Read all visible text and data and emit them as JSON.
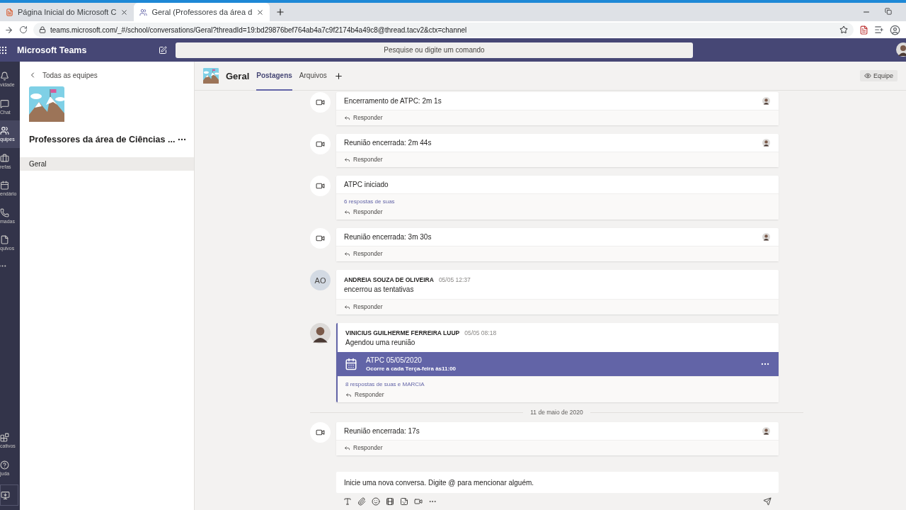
{
  "browser": {
    "tabs": [
      {
        "title": "Página Inicial do Microsoft C",
        "selected": false
      },
      {
        "title": "Geral (Professores da área d",
        "selected": true
      }
    ],
    "url": "teams.microsoft.com/_#/school/conversations/Geral?threadId=19:bd29876bef764ab4a7c9f2174b4a49c8@thread.tacv2&ctx=channel"
  },
  "app": {
    "title": "Microsoft Teams",
    "search": {
      "placeholder": "Pesquise ou digite um comando"
    }
  },
  "rail": {
    "items": [
      {
        "kind": "activity",
        "label": "vidade",
        "selected": false
      },
      {
        "kind": "chat",
        "label": "Chat",
        "selected": false
      },
      {
        "kind": "teams",
        "label": "quipes",
        "selected": true
      },
      {
        "kind": "assignments",
        "label": "refas",
        "selected": false
      },
      {
        "kind": "calendar",
        "label": "endário",
        "selected": false
      },
      {
        "kind": "calls",
        "label": "madas",
        "selected": false
      },
      {
        "kind": "files",
        "label": "quivos",
        "selected": false
      }
    ],
    "bottom": [
      {
        "kind": "apps",
        "label": "cativos"
      },
      {
        "kind": "help",
        "label": "juda"
      }
    ]
  },
  "team_panel": {
    "back": "Todas as equipes",
    "team_name": "Professores da área de Ciências ...",
    "channels": [
      {
        "name": "Geral",
        "selected": true
      }
    ]
  },
  "channel": {
    "name": "Geral",
    "tabs": [
      {
        "label": "Postagens",
        "selected": true
      },
      {
        "label": "Arquivos",
        "selected": false
      }
    ],
    "team_button": "Equipe"
  },
  "messages": [
    {
      "kind": "event",
      "title": "Encerramento de ATPC: 2m 1s",
      "participant": true,
      "reply": "Responder"
    },
    {
      "kind": "event",
      "title": "Reunião encerrada: 2m 44s",
      "participant": true,
      "reply": "Responder"
    },
    {
      "kind": "event",
      "title": "ATPC iniciado",
      "participant": false,
      "replies": "6 respostas de suas",
      "reply": "Responder"
    },
    {
      "kind": "event",
      "title": "Reunião encerrada: 3m 30s",
      "participant": true,
      "reply": "Responder"
    },
    {
      "kind": "post",
      "author": "ANDREIA SOUZA DE OLIVEIRA",
      "initials": "AO",
      "time": "05/05 12:37",
      "text": "encerrou as tentativas",
      "reply": "Responder"
    },
    {
      "kind": "post",
      "author": "VINICIUS GUILHERME FERREIRA LUUP",
      "time": "05/05 08:18",
      "text": "Agendou uma reunião",
      "meeting": {
        "title": "ATPC 05/05/2020",
        "subtitle": "Ocorre a cada Terça-feira às11:00"
      },
      "replies": "8 respostas de suas e MARCIA",
      "reply": "Responder"
    },
    {
      "kind": "divider",
      "text": "11 de maio de 2020"
    },
    {
      "kind": "event",
      "title": "Reunião encerrada: 17s",
      "participant": true,
      "reply": "Responder"
    }
  ],
  "composer": {
    "placeholder": "Inicie uma nova conversa. Digite @ para mencionar alguém."
  }
}
